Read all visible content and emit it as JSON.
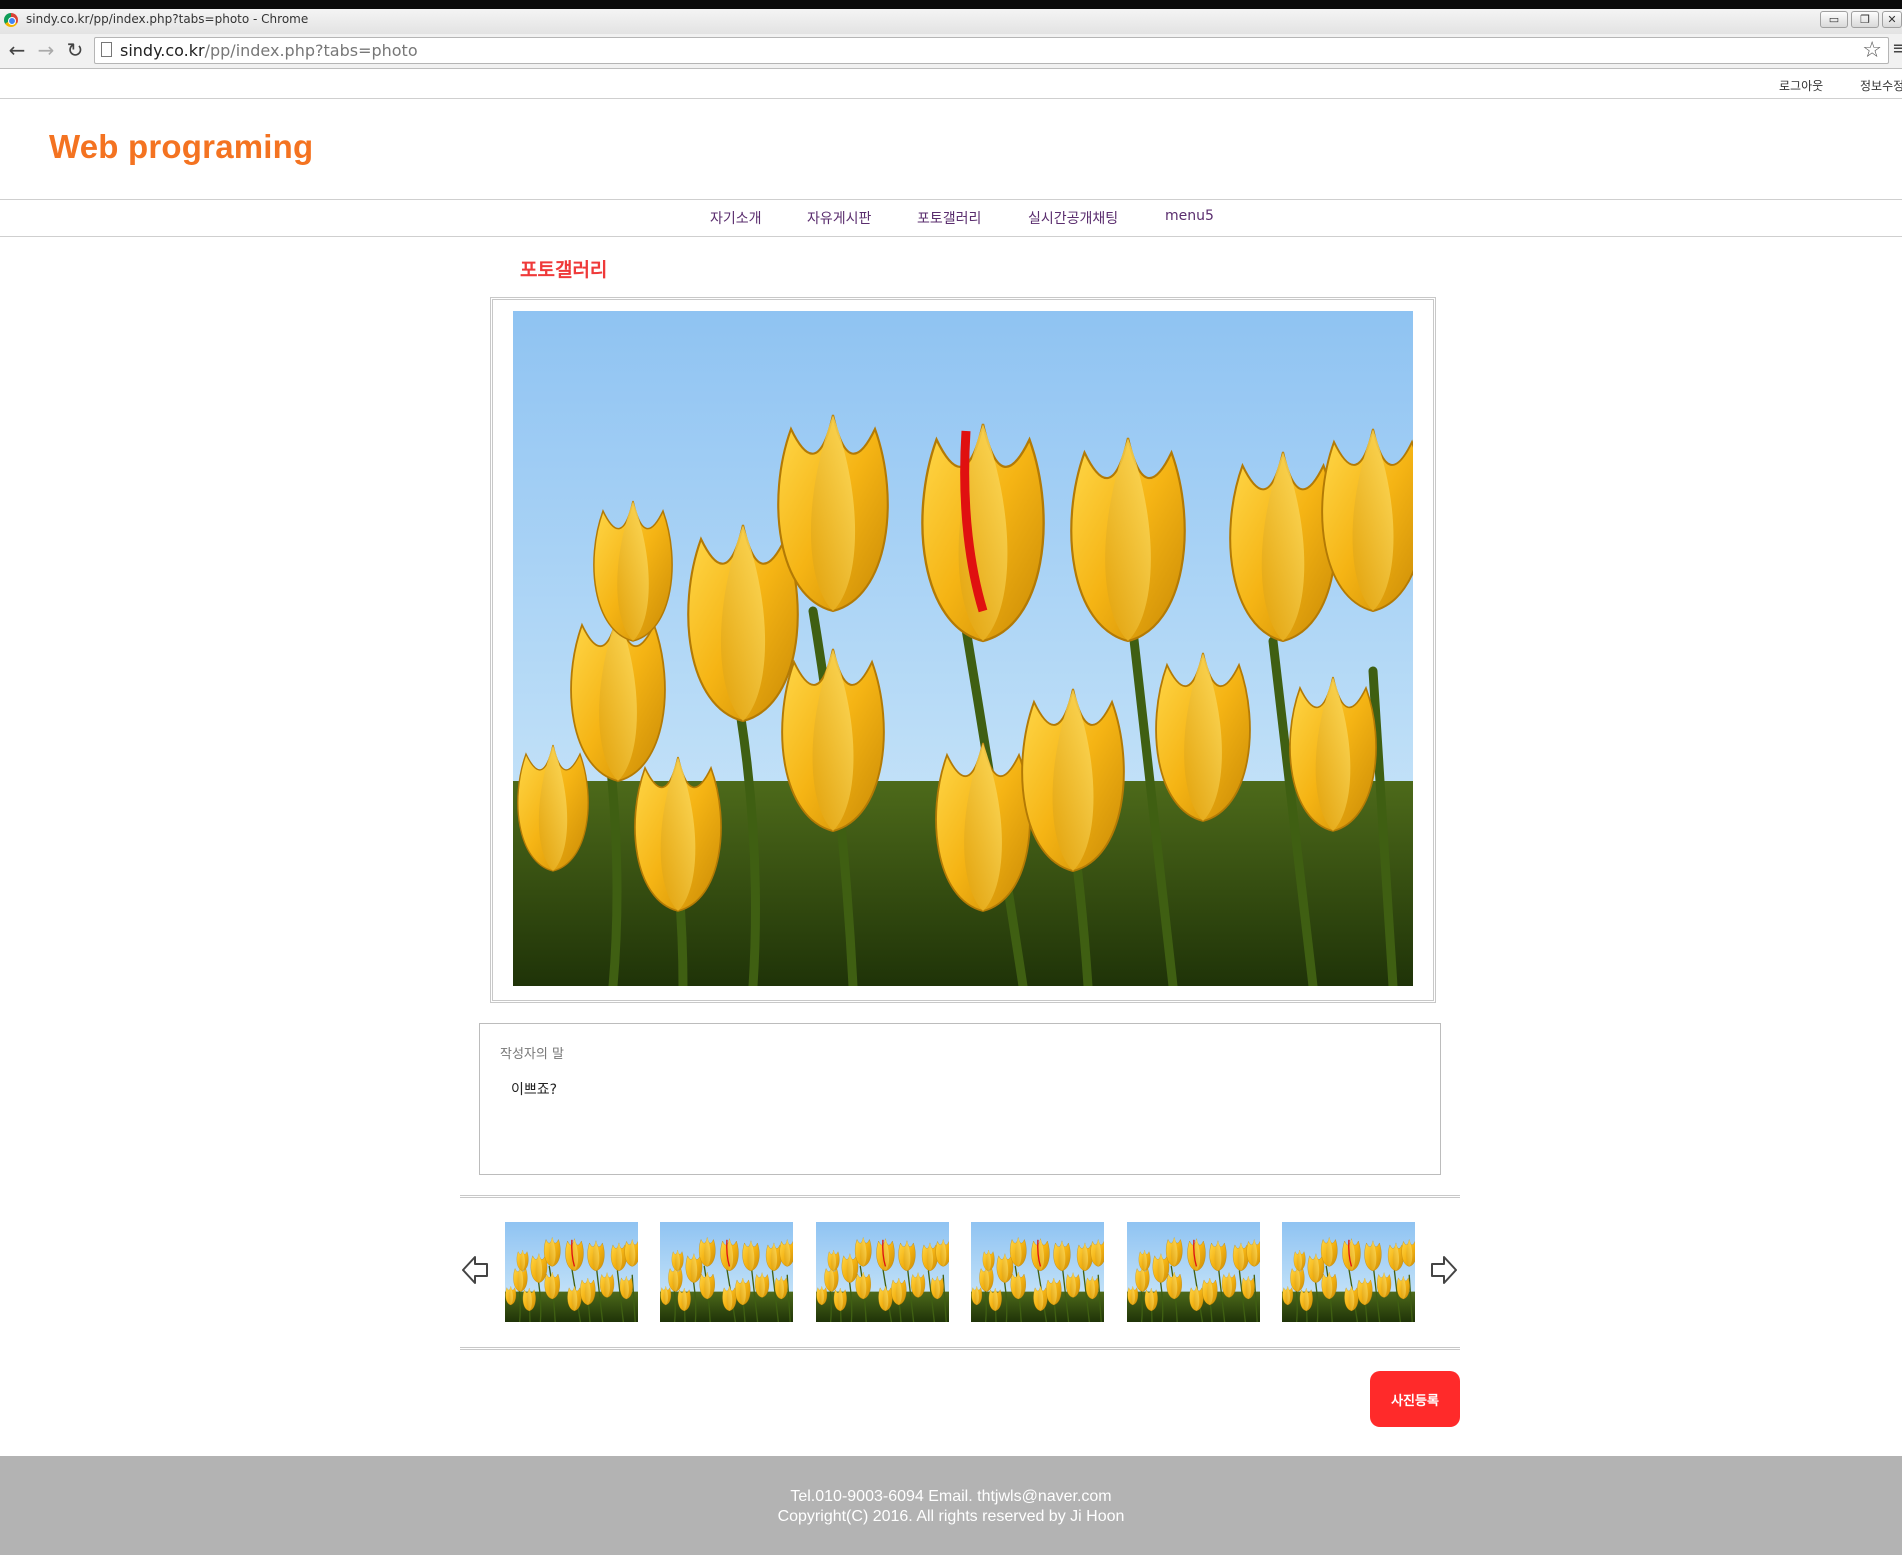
{
  "browser": {
    "window_title": "sindy.co.kr/pp/index.php?tabs=photo - Chrome",
    "url_host": "sindy.co.kr",
    "url_rest": "/pp/index.php?tabs=photo",
    "icons": [
      "back-icon",
      "forward-icon",
      "reload-icon",
      "page-icon",
      "star-icon",
      "menu-icon"
    ],
    "window_buttons": {
      "minimize": "▭",
      "restore": "❐",
      "close": "✕"
    }
  },
  "top_links": {
    "logout": "로그아웃",
    "edit_info": "정보수정"
  },
  "site": {
    "logo": "Web programing",
    "logo_color": "#f47321"
  },
  "nav": {
    "items": [
      {
        "label": "자기소개"
      },
      {
        "label": "자유게시판"
      },
      {
        "label": "포토갤러리"
      },
      {
        "label": "실시간공개채팅"
      },
      {
        "label": "menu5"
      }
    ]
  },
  "gallery": {
    "title": "포토갤러리",
    "title_color": "#ef3a3a",
    "photo_subject": "yellow tulips under blue sky",
    "comment_label": "작성자의 말",
    "comment_text": "이쁘죠?",
    "thumbnails": [
      "tulips",
      "tulips",
      "tulips",
      "tulips",
      "tulips",
      "tulips"
    ],
    "prev_icon": "arrow-left-icon",
    "next_icon": "arrow-right-icon",
    "register_button": "사진등록",
    "register_color": "#ff2a2a"
  },
  "footer": {
    "line1": "Tel.010-9003-6094 Email. thtjwls@naver.com",
    "line2": "Copyright(C) 2016. All rights reserved by Ji Hoon"
  }
}
